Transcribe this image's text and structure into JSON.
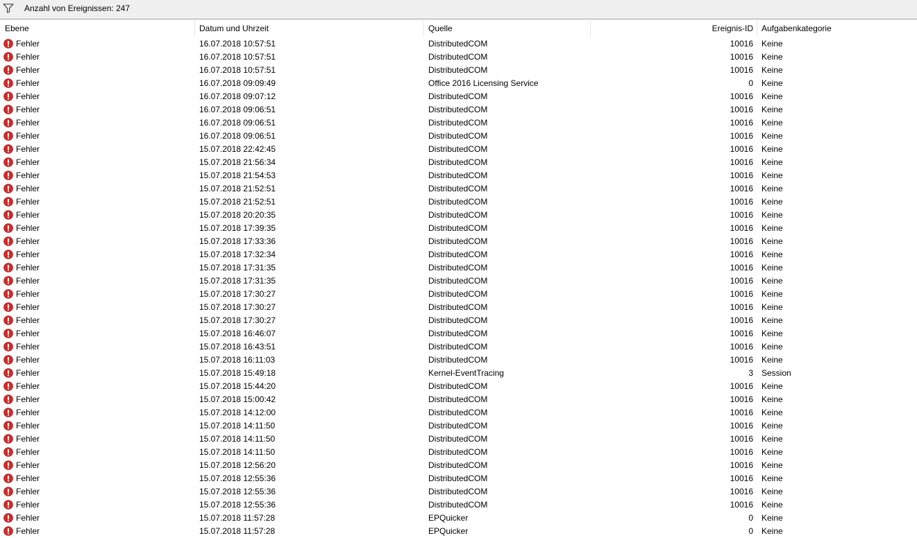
{
  "toolbar": {
    "filter_icon": "filter-icon",
    "count_label": "Anzahl von Ereignissen: 247"
  },
  "columns": {
    "level": "Ebene",
    "date": "Datum und Uhrzeit",
    "source": "Quelle",
    "event_id": "Ereignis-ID",
    "category": "Aufgabenkategorie"
  },
  "colors": {
    "error_red": "#d42a2a",
    "toolbar_bg": "#f0f0f0"
  },
  "rows": [
    {
      "icon": "error-icon",
      "level": "Fehler",
      "date": "16.07.2018 10:57:51",
      "source": "DistributedCOM",
      "id": "10016",
      "category": "Keine"
    },
    {
      "icon": "error-icon",
      "level": "Fehler",
      "date": "16.07.2018 10:57:51",
      "source": "DistributedCOM",
      "id": "10016",
      "category": "Keine"
    },
    {
      "icon": "error-icon",
      "level": "Fehler",
      "date": "16.07.2018 10:57:51",
      "source": "DistributedCOM",
      "id": "10016",
      "category": "Keine"
    },
    {
      "icon": "error-icon",
      "level": "Fehler",
      "date": "16.07.2018 09:09:49",
      "source": "Office 2016 Licensing Service",
      "id": "0",
      "category": "Keine"
    },
    {
      "icon": "error-icon",
      "level": "Fehler",
      "date": "16.07.2018 09:07:12",
      "source": "DistributedCOM",
      "id": "10016",
      "category": "Keine"
    },
    {
      "icon": "error-icon",
      "level": "Fehler",
      "date": "16.07.2018 09:06:51",
      "source": "DistributedCOM",
      "id": "10016",
      "category": "Keine"
    },
    {
      "icon": "error-icon",
      "level": "Fehler",
      "date": "16.07.2018 09:06:51",
      "source": "DistributedCOM",
      "id": "10016",
      "category": "Keine"
    },
    {
      "icon": "error-icon",
      "level": "Fehler",
      "date": "16.07.2018 09:06:51",
      "source": "DistributedCOM",
      "id": "10016",
      "category": "Keine"
    },
    {
      "icon": "error-icon",
      "level": "Fehler",
      "date": "15.07.2018 22:42:45",
      "source": "DistributedCOM",
      "id": "10016",
      "category": "Keine"
    },
    {
      "icon": "error-icon",
      "level": "Fehler",
      "date": "15.07.2018 21:56:34",
      "source": "DistributedCOM",
      "id": "10016",
      "category": "Keine"
    },
    {
      "icon": "error-icon",
      "level": "Fehler",
      "date": "15.07.2018 21:54:53",
      "source": "DistributedCOM",
      "id": "10016",
      "category": "Keine"
    },
    {
      "icon": "error-icon",
      "level": "Fehler",
      "date": "15.07.2018 21:52:51",
      "source": "DistributedCOM",
      "id": "10016",
      "category": "Keine"
    },
    {
      "icon": "error-icon",
      "level": "Fehler",
      "date": "15.07.2018 21:52:51",
      "source": "DistributedCOM",
      "id": "10016",
      "category": "Keine"
    },
    {
      "icon": "error-icon",
      "level": "Fehler",
      "date": "15.07.2018 20:20:35",
      "source": "DistributedCOM",
      "id": "10016",
      "category": "Keine"
    },
    {
      "icon": "error-icon",
      "level": "Fehler",
      "date": "15.07.2018 17:39:35",
      "source": "DistributedCOM",
      "id": "10016",
      "category": "Keine"
    },
    {
      "icon": "error-icon",
      "level": "Fehler",
      "date": "15.07.2018 17:33:36",
      "source": "DistributedCOM",
      "id": "10016",
      "category": "Keine"
    },
    {
      "icon": "error-icon",
      "level": "Fehler",
      "date": "15.07.2018 17:32:34",
      "source": "DistributedCOM",
      "id": "10016",
      "category": "Keine"
    },
    {
      "icon": "error-icon",
      "level": "Fehler",
      "date": "15.07.2018 17:31:35",
      "source": "DistributedCOM",
      "id": "10016",
      "category": "Keine"
    },
    {
      "icon": "error-icon",
      "level": "Fehler",
      "date": "15.07.2018 17:31:35",
      "source": "DistributedCOM",
      "id": "10016",
      "category": "Keine"
    },
    {
      "icon": "error-icon",
      "level": "Fehler",
      "date": "15.07.2018 17:30:27",
      "source": "DistributedCOM",
      "id": "10016",
      "category": "Keine"
    },
    {
      "icon": "error-icon",
      "level": "Fehler",
      "date": "15.07.2018 17:30:27",
      "source": "DistributedCOM",
      "id": "10016",
      "category": "Keine"
    },
    {
      "icon": "error-icon",
      "level": "Fehler",
      "date": "15.07.2018 17:30:27",
      "source": "DistributedCOM",
      "id": "10016",
      "category": "Keine"
    },
    {
      "icon": "error-icon",
      "level": "Fehler",
      "date": "15.07.2018 16:46:07",
      "source": "DistributedCOM",
      "id": "10016",
      "category": "Keine"
    },
    {
      "icon": "error-icon",
      "level": "Fehler",
      "date": "15.07.2018 16:43:51",
      "source": "DistributedCOM",
      "id": "10016",
      "category": "Keine"
    },
    {
      "icon": "error-icon",
      "level": "Fehler",
      "date": "15.07.2018 16:11:03",
      "source": "DistributedCOM",
      "id": "10016",
      "category": "Keine"
    },
    {
      "icon": "error-icon",
      "level": "Fehler",
      "date": "15.07.2018 15:49:18",
      "source": "Kernel-EventTracing",
      "id": "3",
      "category": "Session"
    },
    {
      "icon": "error-icon",
      "level": "Fehler",
      "date": "15.07.2018 15:44:20",
      "source": "DistributedCOM",
      "id": "10016",
      "category": "Keine"
    },
    {
      "icon": "error-icon",
      "level": "Fehler",
      "date": "15.07.2018 15:00:42",
      "source": "DistributedCOM",
      "id": "10016",
      "category": "Keine"
    },
    {
      "icon": "error-icon",
      "level": "Fehler",
      "date": "15.07.2018 14:12:00",
      "source": "DistributedCOM",
      "id": "10016",
      "category": "Keine"
    },
    {
      "icon": "error-icon",
      "level": "Fehler",
      "date": "15.07.2018 14:11:50",
      "source": "DistributedCOM",
      "id": "10016",
      "category": "Keine"
    },
    {
      "icon": "error-icon",
      "level": "Fehler",
      "date": "15.07.2018 14:11:50",
      "source": "DistributedCOM",
      "id": "10016",
      "category": "Keine"
    },
    {
      "icon": "error-icon",
      "level": "Fehler",
      "date": "15.07.2018 14:11:50",
      "source": "DistributedCOM",
      "id": "10016",
      "category": "Keine"
    },
    {
      "icon": "error-icon",
      "level": "Fehler",
      "date": "15.07.2018 12:56:20",
      "source": "DistributedCOM",
      "id": "10016",
      "category": "Keine"
    },
    {
      "icon": "error-icon",
      "level": "Fehler",
      "date": "15.07.2018 12:55:36",
      "source": "DistributedCOM",
      "id": "10016",
      "category": "Keine"
    },
    {
      "icon": "error-icon",
      "level": "Fehler",
      "date": "15.07.2018 12:55:36",
      "source": "DistributedCOM",
      "id": "10016",
      "category": "Keine"
    },
    {
      "icon": "error-icon",
      "level": "Fehler",
      "date": "15.07.2018 12:55:36",
      "source": "DistributedCOM",
      "id": "10016",
      "category": "Keine"
    },
    {
      "icon": "error-icon",
      "level": "Fehler",
      "date": "15.07.2018 11:57:28",
      "source": "EPQuicker",
      "id": "0",
      "category": "Keine"
    },
    {
      "icon": "error-icon",
      "level": "Fehler",
      "date": "15.07.2018 11:57:28",
      "source": "EPQuicker",
      "id": "0",
      "category": "Keine"
    }
  ]
}
